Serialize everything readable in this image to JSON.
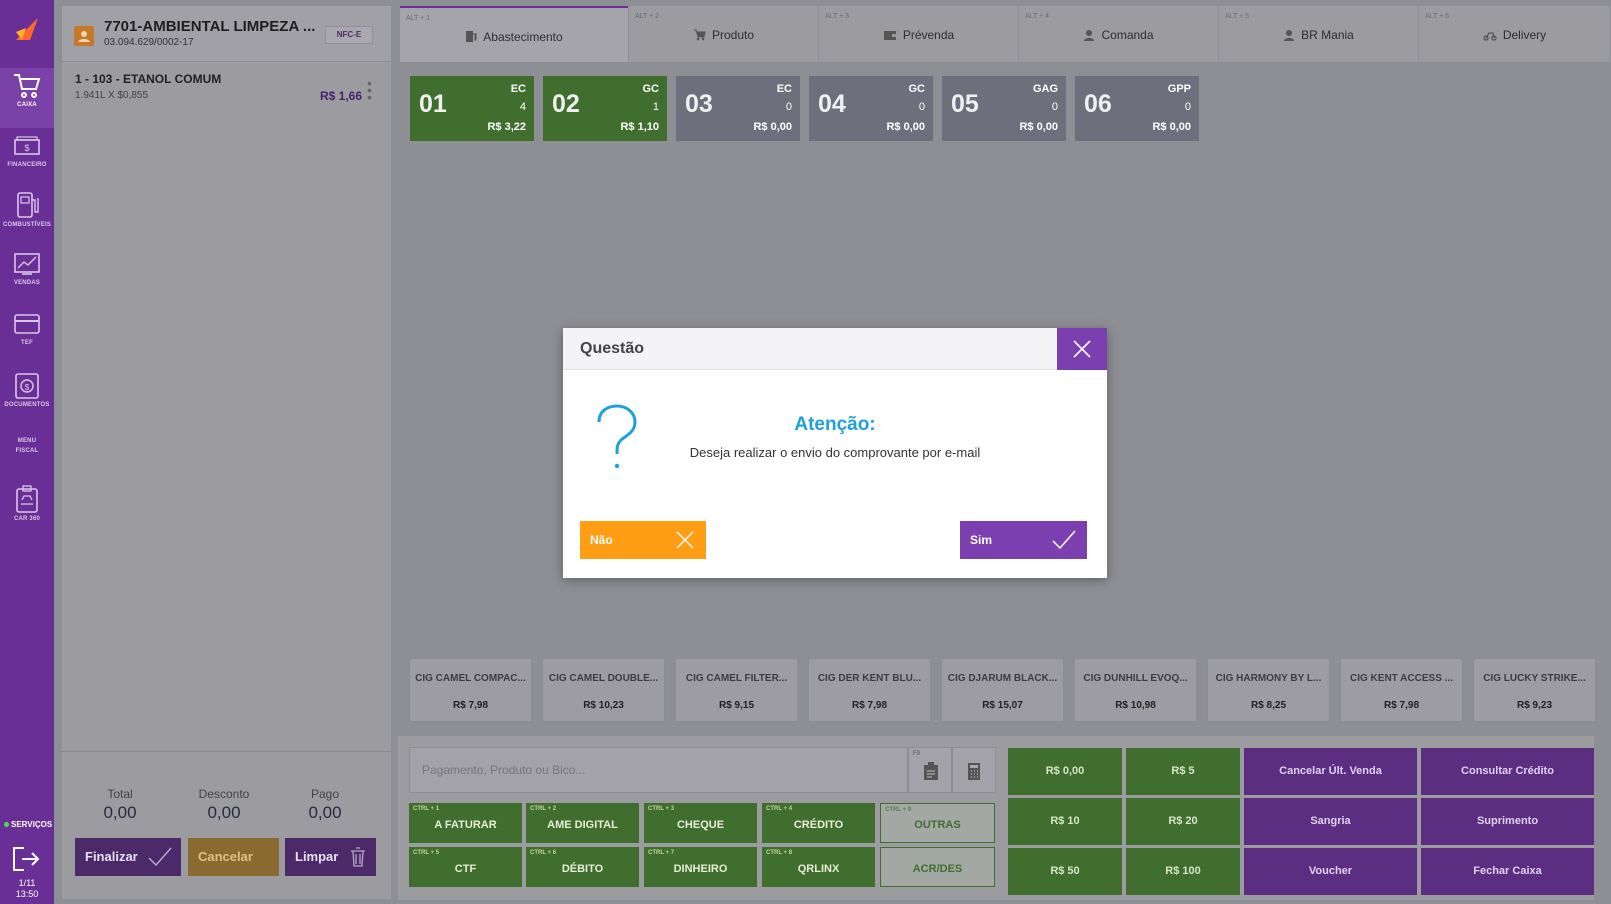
{
  "sidebar": {
    "items": [
      {
        "label": "CAIXA",
        "icon": "cart-icon"
      },
      {
        "label": "FINANCEIRO",
        "icon": "money-icon"
      },
      {
        "label": "COMBUSTÍVEIS",
        "icon": "fuel-pump-icon"
      },
      {
        "label": "VENDAS",
        "icon": "chart-icon"
      },
      {
        "label": "TEF",
        "icon": "card-icon"
      },
      {
        "label": "DOCUMENTOS",
        "icon": "document-icon"
      },
      {
        "label": "MENU FISCAL",
        "icon": "none"
      },
      {
        "label": "CAR 360",
        "icon": "car-icon"
      }
    ],
    "servicos": "SERVIÇOS",
    "date": "1/11",
    "time": "13:50"
  },
  "left_panel": {
    "company": "7701-AMBIENTAL LIMPEZA ...",
    "cnpj": "03.094.629/0002-17",
    "doc_type": "NFC-E",
    "item": {
      "title": "1 - 103 - ETANOL COMUM",
      "detail": "1.941L X $0,855",
      "price": "R$ 1,66"
    },
    "totals": {
      "total_label": "Total",
      "total_value": "0,00",
      "discount_label": "Desconto",
      "discount_value": "0,00",
      "paid_label": "Pago",
      "paid_value": "0,00"
    },
    "buttons": {
      "finalize": "Finalizar",
      "cancel": "Cancelar",
      "clear": "Limpar"
    }
  },
  "tabs": [
    {
      "shortcut": "ALT + 1",
      "label": "Abastecimento"
    },
    {
      "shortcut": "ALT + 2",
      "label": "Produto"
    },
    {
      "shortcut": "ALT + 3",
      "label": "Prévenda"
    },
    {
      "shortcut": "ALT + 4",
      "label": "Comanda"
    },
    {
      "shortcut": "ALT + 5",
      "label": "BR Mania"
    },
    {
      "shortcut": "ALT + 6",
      "label": "Delivery"
    }
  ],
  "pumps": [
    {
      "number": "01",
      "code": "EC",
      "qty": "4",
      "price": "R$ 3,22",
      "active": true
    },
    {
      "number": "02",
      "code": "GC",
      "qty": "1",
      "price": "R$ 1,10",
      "active": true
    },
    {
      "number": "03",
      "code": "EC",
      "qty": "0",
      "price": "R$ 0,00",
      "active": false
    },
    {
      "number": "04",
      "code": "GC",
      "qty": "0",
      "price": "R$ 0,00",
      "active": false
    },
    {
      "number": "05",
      "code": "GAG",
      "qty": "0",
      "price": "R$ 0,00",
      "active": false
    },
    {
      "number": "06",
      "code": "GPP",
      "qty": "0",
      "price": "R$ 0,00",
      "active": false
    }
  ],
  "products": [
    {
      "name": "CIG CAMEL COMPAC...",
      "price": "R$ 7,98"
    },
    {
      "name": "CIG CAMEL DOUBLE...",
      "price": "R$ 10,23"
    },
    {
      "name": "CIG CAMEL FILTER...",
      "price": "R$ 9,15"
    },
    {
      "name": "CIG DER KENT BLU...",
      "price": "R$ 7,98"
    },
    {
      "name": "CIG DJARUM BLACK...",
      "price": "R$ 15,07"
    },
    {
      "name": "CIG DUNHILL EVOQ...",
      "price": "R$ 10,98"
    },
    {
      "name": "CIG HARMONY BY L...",
      "price": "R$ 8,25"
    },
    {
      "name": "CIG KENT ACCESS ...",
      "price": "R$ 7,98"
    },
    {
      "name": "CIG LUCKY STRIKE...",
      "price": "R$ 9,23"
    }
  ],
  "search": {
    "placeholder": "Pagamento, Produto ou Bico...",
    "f9": "F9"
  },
  "payments": [
    {
      "shortcut": "CTRL + 1",
      "label": "A FATURAR"
    },
    {
      "shortcut": "CTRL + 2",
      "label": "AME DIGITAL"
    },
    {
      "shortcut": "CTRL + 3",
      "label": "CHEQUE"
    },
    {
      "shortcut": "CTRL + 4",
      "label": "CRÉDITO"
    },
    {
      "shortcut": "CTRL + 9",
      "label": "OUTRAS"
    },
    {
      "shortcut": "CTRL + 5",
      "label": "CTF"
    },
    {
      "shortcut": "CTRL + 6",
      "label": "DÉBITO"
    },
    {
      "shortcut": "CTRL + 7",
      "label": "DINHEIRO"
    },
    {
      "shortcut": "CTRL + 8",
      "label": "QRLINX"
    },
    {
      "shortcut": "",
      "label": "ACR/DES"
    }
  ],
  "quick_values": [
    "R$ 0,00",
    "R$ 5",
    "R$ 10",
    "R$ 20",
    "R$ 50",
    "R$ 100"
  ],
  "actions": [
    "Cancelar Últ. Venda",
    "Consultar Crédito",
    "Sangria",
    "Suprimento",
    "Voucher",
    "Fechar Caixa"
  ],
  "dialog": {
    "title": "Questão",
    "heading": "Atenção:",
    "message": "Deseja realizar o envio do comprovante por e-mail",
    "no": "Não",
    "yes": "Sim"
  },
  "colors": {
    "brand_purple": "#7b3fb0",
    "green": "#3f6e2f",
    "orange": "#ff9e14",
    "accent_blue": "#1ea0d8"
  }
}
